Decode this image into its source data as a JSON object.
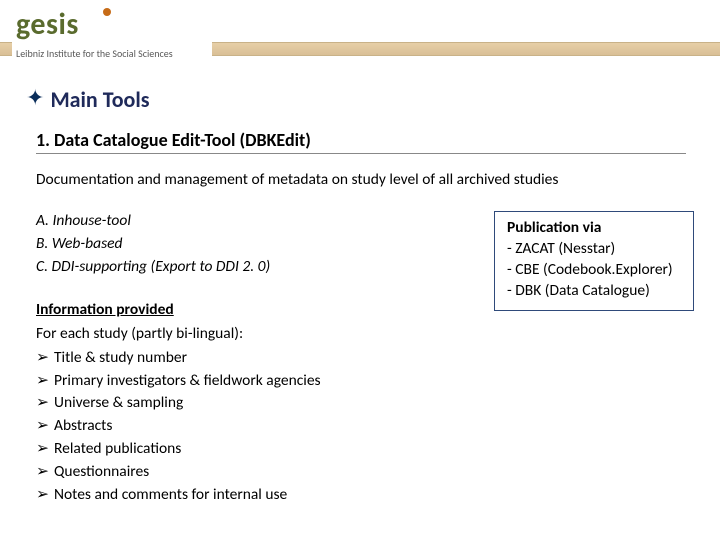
{
  "header": {
    "logo_text": "gesis",
    "logo_sub": "Leibniz Institute for the Social Sciences"
  },
  "title": "Main Tools",
  "subtitle": "1. Data Catalogue Edit-Tool (DBKEdit)",
  "description": "Documentation and management of metadata on study level of all archived studies",
  "features": {
    "a": "A. Inhouse-tool",
    "b": "B. Web-based",
    "c": "C. DDI-supporting (Export to DDI 2. 0)"
  },
  "info": {
    "heading": "Information provided",
    "sub": "For each study (partly bi-lingual):",
    "items": [
      "Title & study number",
      "Primary investigators & fieldwork agencies",
      "Universe & sampling",
      "Abstracts",
      "Related publications",
      "Questionnaires",
      "Notes and comments for internal use"
    ]
  },
  "pub": {
    "heading": "Publication via",
    "lines": [
      "- ZACAT (Nesstar)",
      "- CBE (Codebook.Explorer)",
      "- DBK (Data Catalogue)"
    ]
  }
}
